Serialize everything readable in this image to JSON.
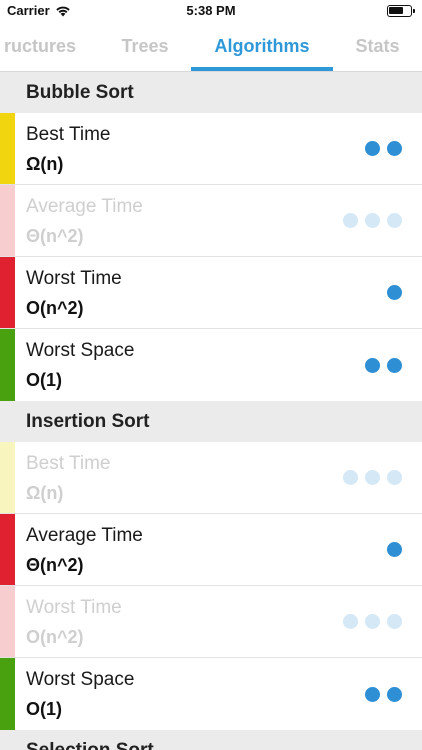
{
  "status_bar": {
    "carrier": "Carrier",
    "time": "5:38 PM"
  },
  "tabs": [
    {
      "label": "ructures"
    },
    {
      "label": "Trees"
    },
    {
      "label": "Algorithms"
    },
    {
      "label": "Stats"
    }
  ],
  "colors": {
    "accent": "#2e98d8",
    "yellow": "#f0d50f",
    "pale_yellow": "#f9f5bf",
    "red": "#e0212f",
    "pale_red": "#f7cdd0",
    "green": "#4aa110"
  },
  "sections": [
    {
      "title": "Bubble Sort",
      "rows": [
        {
          "title": "Best Time",
          "value": "Ω(n)",
          "dots": 2,
          "dim": false,
          "color": "yellow"
        },
        {
          "title": "Average Time",
          "value": "Θ(n^2)",
          "dots": 3,
          "dim": true,
          "color": "pale_red"
        },
        {
          "title": "Worst Time",
          "value": "O(n^2)",
          "dots": 1,
          "dim": false,
          "color": "red"
        },
        {
          "title": "Worst Space",
          "value": "O(1)",
          "dots": 2,
          "dim": false,
          "color": "green"
        }
      ]
    },
    {
      "title": "Insertion Sort",
      "rows": [
        {
          "title": "Best Time",
          "value": "Ω(n)",
          "dots": 3,
          "dim": true,
          "color": "pale_yellow"
        },
        {
          "title": "Average Time",
          "value": "Θ(n^2)",
          "dots": 1,
          "dim": false,
          "color": "red"
        },
        {
          "title": "Worst Time",
          "value": "O(n^2)",
          "dots": 3,
          "dim": true,
          "color": "pale_red"
        },
        {
          "title": "Worst Space",
          "value": "O(1)",
          "dots": 2,
          "dim": false,
          "color": "green"
        }
      ]
    },
    {
      "title": "Selection Sort",
      "rows": []
    }
  ]
}
